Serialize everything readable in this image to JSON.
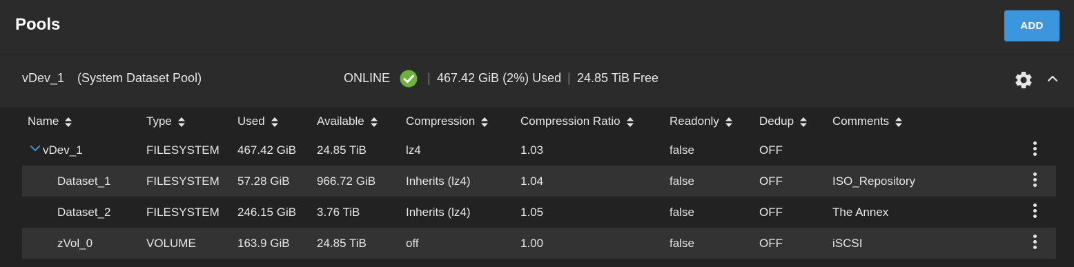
{
  "header": {
    "title": "Pools",
    "add_label": "ADD",
    "accent_color": "#3c96dd"
  },
  "pool": {
    "name": "vDev_1",
    "description": "(System Dataset Pool)",
    "status": "ONLINE",
    "status_icon": "check-circle-icon",
    "status_color": "#6cb33e",
    "separator": "|",
    "used": "467.42 GiB (2%) Used",
    "free": "24.85 TiB Free",
    "settings_icon": "gear-icon",
    "collapse_icon": "chevron-up-icon"
  },
  "table": {
    "columns": [
      "Name",
      "Type",
      "Used",
      "Available",
      "Compression",
      "Compression Ratio",
      "Readonly",
      "Dedup",
      "Comments"
    ],
    "rows": [
      {
        "name": "vDev_1",
        "type": "FILESYSTEM",
        "used": "467.42 GiB",
        "available": "24.85 TiB",
        "compression": "lz4",
        "ratio": "1.03",
        "readonly": "false",
        "dedup": "OFF",
        "comments": ""
      },
      {
        "name": "Dataset_1",
        "type": "FILESYSTEM",
        "used": "57.28 GiB",
        "available": "966.72 GiB",
        "compression": "Inherits (lz4)",
        "ratio": "1.04",
        "readonly": "false",
        "dedup": "OFF",
        "comments": "ISO_Repository"
      },
      {
        "name": "Dataset_2",
        "type": "FILESYSTEM",
        "used": "246.15 GiB",
        "available": "3.76 TiB",
        "compression": "Inherits (lz4)",
        "ratio": "1.05",
        "readonly": "false",
        "dedup": "OFF",
        "comments": "The Annex"
      },
      {
        "name": "zVol_0",
        "type": "VOLUME",
        "used": "163.9 GiB",
        "available": "24.85 TiB",
        "compression": "off",
        "ratio": "1.00",
        "readonly": "false",
        "dedup": "OFF",
        "comments": "iSCSI"
      }
    ]
  }
}
